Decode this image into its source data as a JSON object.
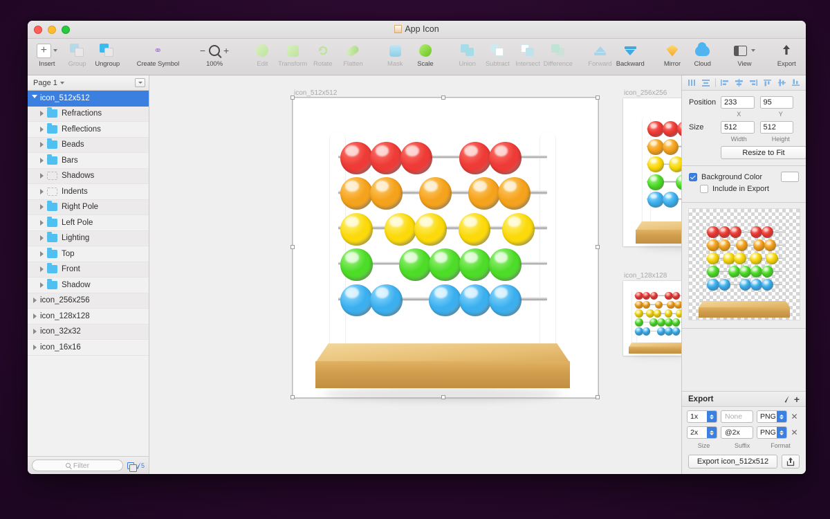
{
  "window": {
    "title": "App Icon",
    "doc_icon": "document-icon"
  },
  "traffic_lights": [
    {
      "name": "close-button",
      "color": "#ff5f57"
    },
    {
      "name": "minimize-button",
      "color": "#ffbd2e"
    },
    {
      "name": "zoom-button",
      "color": "#28c840"
    }
  ],
  "toolbar": {
    "items": [
      {
        "name": "insert",
        "label": "Insert",
        "icon": "plus-icon",
        "dim": false
      },
      {
        "name": "group",
        "label": "Group",
        "icon": "group-icon",
        "dim": true
      },
      {
        "name": "ungroup",
        "label": "Ungroup",
        "icon": "ungroup-icon",
        "dim": false
      },
      {
        "name": "create-symbol",
        "label": "Create Symbol",
        "icon": "symbol-icon",
        "dim": false
      },
      {
        "name": "zoom",
        "label": "100%",
        "icon": "magnifier-icon",
        "dim": false
      },
      {
        "name": "edit",
        "label": "Edit",
        "icon": "edit-blob-icon",
        "dim": true
      },
      {
        "name": "transform",
        "label": "Transform",
        "icon": "transform-icon",
        "dim": true
      },
      {
        "name": "rotate",
        "label": "Rotate",
        "icon": "rotate-icon",
        "dim": true
      },
      {
        "name": "flatten",
        "label": "Flatten",
        "icon": "flatten-icon",
        "dim": true
      },
      {
        "name": "mask",
        "label": "Mask",
        "icon": "mask-icon",
        "dim": true
      },
      {
        "name": "scale",
        "label": "Scale",
        "icon": "scale-icon",
        "dim": false
      },
      {
        "name": "union",
        "label": "Union",
        "icon": "union-icon",
        "dim": true
      },
      {
        "name": "subtract",
        "label": "Subtract",
        "icon": "subtract-icon",
        "dim": true
      },
      {
        "name": "intersect",
        "label": "Intersect",
        "icon": "intersect-icon",
        "dim": true
      },
      {
        "name": "difference",
        "label": "Difference",
        "icon": "difference-icon",
        "dim": true
      },
      {
        "name": "forward",
        "label": "Forward",
        "icon": "forward-icon",
        "dim": true
      },
      {
        "name": "backward",
        "label": "Backward",
        "icon": "backward-icon",
        "dim": false
      },
      {
        "name": "mirror",
        "label": "Mirror",
        "icon": "mirror-diamond-icon",
        "dim": false
      },
      {
        "name": "cloud",
        "label": "Cloud",
        "icon": "cloud-upload-icon",
        "dim": false
      },
      {
        "name": "view",
        "label": "View",
        "icon": "view-panels-icon",
        "dim": false
      },
      {
        "name": "export",
        "label": "Export",
        "icon": "export-arrow-icon",
        "dim": false
      }
    ],
    "zoom_level": "100%",
    "zoom_out": "−",
    "zoom_in": "+"
  },
  "sidebar": {
    "page_label": "Page 1",
    "layers": [
      {
        "label": "icon_512x512",
        "depth": 0,
        "selected": true,
        "folder": "none"
      },
      {
        "label": "Refractions",
        "depth": 1,
        "selected": false,
        "folder": "blue"
      },
      {
        "label": "Reflections",
        "depth": 1,
        "selected": false,
        "folder": "blue"
      },
      {
        "label": "Beads",
        "depth": 1,
        "selected": false,
        "folder": "blue"
      },
      {
        "label": "Bars",
        "depth": 1,
        "selected": false,
        "folder": "blue"
      },
      {
        "label": "Shadows",
        "depth": 1,
        "selected": false,
        "folder": "ghost"
      },
      {
        "label": "Indents",
        "depth": 1,
        "selected": false,
        "folder": "ghost"
      },
      {
        "label": "Right Pole",
        "depth": 1,
        "selected": false,
        "folder": "blue"
      },
      {
        "label": "Left Pole",
        "depth": 1,
        "selected": false,
        "folder": "blue"
      },
      {
        "label": "Lighting",
        "depth": 1,
        "selected": false,
        "folder": "blue"
      },
      {
        "label": "Top",
        "depth": 1,
        "selected": false,
        "folder": "blue"
      },
      {
        "label": "Front",
        "depth": 1,
        "selected": false,
        "folder": "blue"
      },
      {
        "label": "Shadow",
        "depth": 1,
        "selected": false,
        "folder": "blue"
      },
      {
        "label": "icon_256x256",
        "depth": 0,
        "selected": false,
        "folder": "none"
      },
      {
        "label": "icon_128x128",
        "depth": 0,
        "selected": false,
        "folder": "none"
      },
      {
        "label": "icon_32x32",
        "depth": 0,
        "selected": false,
        "folder": "none"
      },
      {
        "label": "icon_16x16",
        "depth": 0,
        "selected": false,
        "folder": "none"
      }
    ],
    "filter_placeholder": "Filter",
    "layer_count": "5"
  },
  "canvas": {
    "artboards": [
      {
        "name": "artboard-512",
        "label": "icon_512x512",
        "selected": true
      },
      {
        "name": "artboard-256",
        "label": "icon_256x256",
        "selected": false
      },
      {
        "name": "artboard-128",
        "label": "icon_128x128",
        "selected": false
      },
      {
        "name": "artboard-32",
        "label": "",
        "selected": false
      },
      {
        "name": "artboard-16",
        "label": "",
        "selected": false
      }
    ]
  },
  "inspector": {
    "align_icons": [
      "align-left-icon",
      "align-center-horizontal-icon",
      "align-left-edges-icon",
      "align-center-icon",
      "align-right-edges-icon",
      "align-top-icon",
      "align-middle-icon",
      "align-bottom-icon"
    ],
    "position_label": "Position",
    "position_x": "233",
    "position_y": "95",
    "x_sublabel": "X",
    "y_sublabel": "Y",
    "size_label": "Size",
    "width": "512",
    "height": "512",
    "width_sublabel": "Width",
    "height_sublabel": "Height",
    "resize_to_fit": "Resize to Fit",
    "background_color_label": "Background Color",
    "background_color_checked": true,
    "background_color_value": "#ffffff",
    "include_in_export_label": "Include in Export",
    "include_in_export_checked": false
  },
  "export": {
    "title": "Export",
    "edit_icon": "pencil-icon",
    "add_icon": "plus-icon",
    "rows": [
      {
        "size": "1x",
        "suffix": "None",
        "suffix_is_placeholder": true,
        "format": "PNG"
      },
      {
        "size": "2x",
        "suffix": "@2x",
        "suffix_is_placeholder": false,
        "format": "PNG"
      }
    ],
    "size_label": "Size",
    "suffix_label": "Suffix",
    "format_label": "Format",
    "export_button": "Export icon_512x512",
    "share_icon": "share-icon"
  },
  "artwork": {
    "description": "wooden abacus app icon",
    "rows": [
      {
        "color_name": "red",
        "hex": "#ee3b37",
        "hi": "#ff7a6e",
        "groups": [
          3,
          2
        ]
      },
      {
        "color_name": "orange",
        "hex": "#f5a21c",
        "hi": "#ffd073",
        "groups": [
          2,
          1,
          2
        ]
      },
      {
        "color_name": "yellow",
        "hex": "#fbd90a",
        "hi": "#fff487",
        "groups": [
          1,
          2,
          1,
          1
        ]
      },
      {
        "color_name": "green",
        "hex": "#4ddc28",
        "hi": "#a8f58c",
        "groups": [
          1,
          4
        ]
      },
      {
        "color_name": "blue",
        "hex": "#3cb0ef",
        "hi": "#96ddff",
        "groups": [
          2,
          3
        ]
      }
    ],
    "wood_light": "#fdeec6",
    "wood_mid": "#e9c279",
    "wood_dark": "#c08f42"
  }
}
